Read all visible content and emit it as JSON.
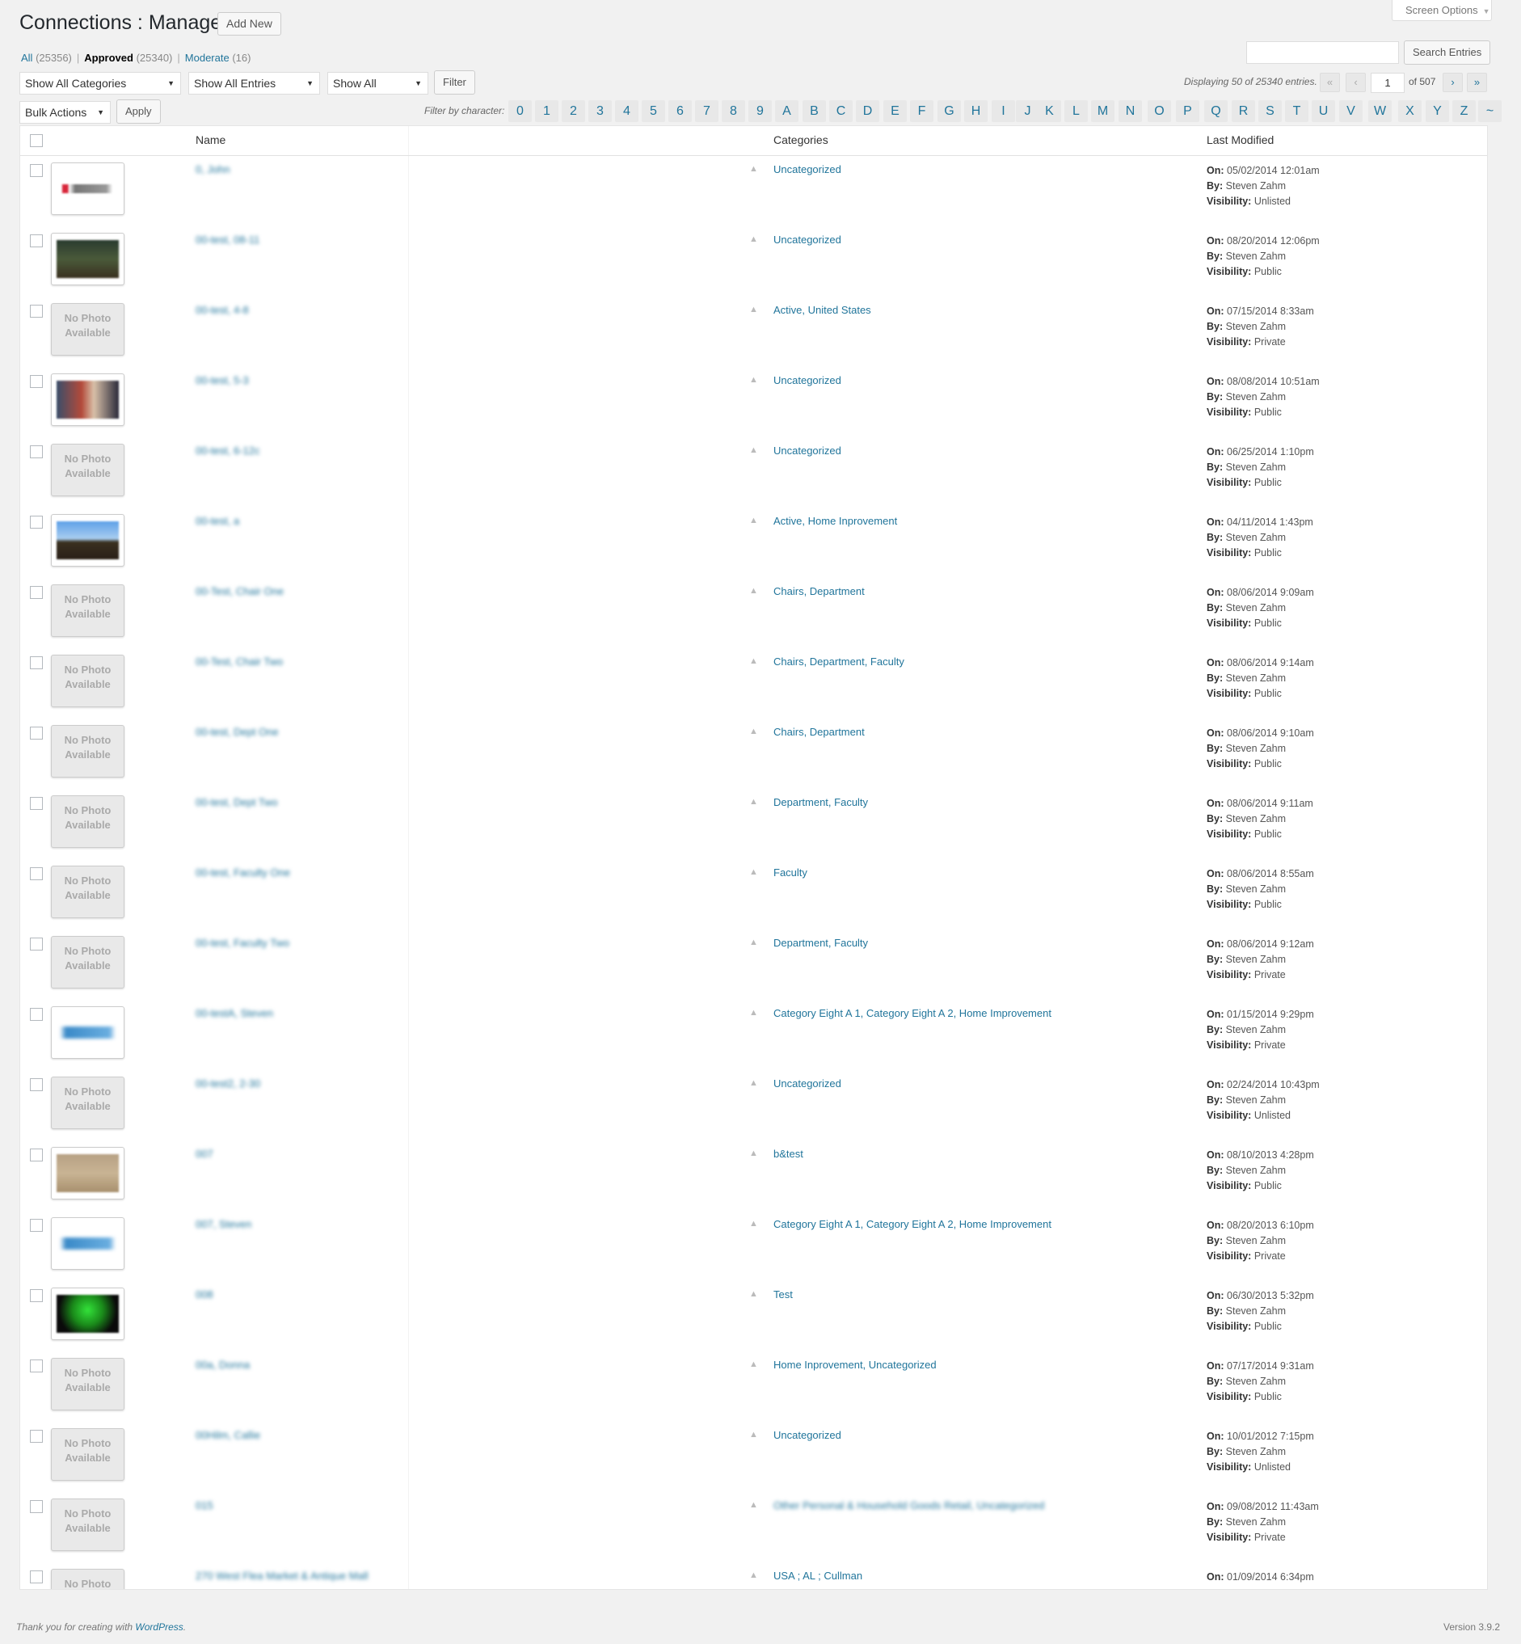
{
  "header": {
    "title": "Connections : Manage",
    "add_new": "Add New",
    "screen_options": "Screen Options"
  },
  "views": {
    "all_label": "All",
    "all_count": "(25356)",
    "approved_label": "Approved",
    "approved_count": "(25340)",
    "moderate_label": "Moderate",
    "moderate_count": "(16)",
    "separator": "|"
  },
  "search": {
    "value": "",
    "button": "Search Entries"
  },
  "filters": {
    "categories": "Show All Categories",
    "entries": "Show All Entries",
    "visibility": "Show All",
    "filter_button": "Filter",
    "bulk_actions": "Bulk Actions",
    "apply_button": "Apply"
  },
  "pagination": {
    "displaying": "Displaying 50 of 25340 entries.",
    "first": "«",
    "prev": "‹",
    "current": "1",
    "of": "of 507",
    "next": "›",
    "last": "»"
  },
  "char_filter": {
    "label": "Filter by character:",
    "chars": [
      "0",
      "1",
      "2",
      "3",
      "4",
      "5",
      "6",
      "7",
      "8",
      "9",
      "A",
      "B",
      "C",
      "D",
      "E",
      "F",
      "G",
      "H",
      "I",
      "J",
      "K",
      "L",
      "M",
      "N",
      "O",
      "P",
      "Q",
      "R",
      "S",
      "T",
      "U",
      "V",
      "W",
      "X",
      "Y",
      "Z",
      "~"
    ]
  },
  "table": {
    "columns": {
      "name": "Name",
      "categories": "Categories",
      "last_modified": "Last Modified"
    },
    "labels": {
      "on": "On:",
      "by": "By:",
      "visibility": "Visibility:"
    },
    "no_photo": "No Photo Available",
    "rows": [
      {
        "name": "0, John",
        "categories": "Uncategorized",
        "on": "05/02/2014 12:01am",
        "by": "Steven Zahm",
        "visibility": "Unlisted",
        "thumb": "logo-red"
      },
      {
        "name": "00-test, 08-11",
        "categories": "Uncategorized",
        "on": "08/20/2014 12:06pm",
        "by": "Steven Zahm",
        "visibility": "Public",
        "thumb": "photo-dark"
      },
      {
        "name": "00-test, 4-8",
        "categories": "Active, United States",
        "on": "07/15/2014 8:33am",
        "by": "Steven Zahm",
        "visibility": "Private",
        "thumb": "none"
      },
      {
        "name": "00-test, 5-3",
        "categories": "Uncategorized",
        "on": "08/08/2014 10:51am",
        "by": "Steven Zahm",
        "visibility": "Public",
        "thumb": "photo-people"
      },
      {
        "name": "00-test, 6-12c",
        "categories": "Uncategorized",
        "on": "06/25/2014 1:10pm",
        "by": "Steven Zahm",
        "visibility": "Public",
        "thumb": "none"
      },
      {
        "name": "00-test, a",
        "categories": "Active, Home Inprovement",
        "on": "04/11/2014 1:43pm",
        "by": "Steven Zahm",
        "visibility": "Public",
        "thumb": "photo-sky"
      },
      {
        "name": "00-Test, Chair One",
        "categories": "Chairs, Department",
        "on": "08/06/2014 9:09am",
        "by": "Steven Zahm",
        "visibility": "Public",
        "thumb": "none"
      },
      {
        "name": "00-Test, Chair Two",
        "categories": "Chairs, Department, Faculty",
        "on": "08/06/2014 9:14am",
        "by": "Steven Zahm",
        "visibility": "Public",
        "thumb": "none"
      },
      {
        "name": "00-test, Dept One",
        "categories": "Chairs, Department",
        "on": "08/06/2014 9:10am",
        "by": "Steven Zahm",
        "visibility": "Public",
        "thumb": "none"
      },
      {
        "name": "00-test, Dept Two",
        "categories": "Department, Faculty",
        "on": "08/06/2014 9:11am",
        "by": "Steven Zahm",
        "visibility": "Public",
        "thumb": "none"
      },
      {
        "name": "00-test, Faculty One",
        "categories": "Faculty",
        "on": "08/06/2014 8:55am",
        "by": "Steven Zahm",
        "visibility": "Public",
        "thumb": "none"
      },
      {
        "name": "00-test, Faculty Two",
        "categories": "Department, Faculty",
        "on": "08/06/2014 9:12am",
        "by": "Steven Zahm",
        "visibility": "Private",
        "thumb": "none"
      },
      {
        "name": "00-testA, Steven",
        "categories": "Category Eight A 1, Category Eight A 2, Home Improvement",
        "on": "01/15/2014 9:29pm",
        "by": "Steven Zahm",
        "visibility": "Private",
        "thumb": "logo-blue"
      },
      {
        "name": "00-test2, 2-30",
        "categories": "Uncategorized",
        "on": "02/24/2014 10:43pm",
        "by": "Steven Zahm",
        "visibility": "Unlisted",
        "thumb": "none"
      },
      {
        "name": "007",
        "categories": "b&test",
        "on": "08/10/2013 4:28pm",
        "by": "Steven Zahm",
        "visibility": "Public",
        "thumb": "photo-help"
      },
      {
        "name": "007, Steven",
        "categories": "Category Eight A 1, Category Eight A 2, Home Improvement",
        "on": "08/20/2013 6:10pm",
        "by": "Steven Zahm",
        "visibility": "Private",
        "thumb": "logo-blue"
      },
      {
        "name": "008",
        "categories": "Test",
        "on": "06/30/2013 5:32pm",
        "by": "Steven Zahm",
        "visibility": "Public",
        "thumb": "photo-green"
      },
      {
        "name": "00a, Donna",
        "categories": "Home Inprovement, Uncategorized",
        "on": "07/17/2014 9:31am",
        "by": "Steven Zahm",
        "visibility": "Public",
        "thumb": "none"
      },
      {
        "name": "00Hilm, Callie",
        "categories": "Uncategorized",
        "on": "10/01/2012 7:15pm",
        "by": "Steven Zahm",
        "visibility": "Unlisted",
        "thumb": "none"
      },
      {
        "name": "015",
        "categories": "Other Personal & Household Goods Retail, Uncategorized",
        "on": "09/08/2012 11:43am",
        "by": "Steven Zahm",
        "visibility": "Private",
        "thumb": "none",
        "blur_cats": true
      },
      {
        "name": "270 West Flea Market & Antique Mall",
        "categories": "USA ; AL ; Cullman",
        "on": "01/09/2014 6:34pm",
        "by": "",
        "visibility": "",
        "thumb": "none"
      }
    ]
  },
  "footer": {
    "thanks": "Thank you for creating with ",
    "wordpress": "WordPress",
    "period": ".",
    "version": "Version 3.9.2"
  },
  "colors": {
    "link": "#21759b",
    "background": "#f1f1f1"
  }
}
